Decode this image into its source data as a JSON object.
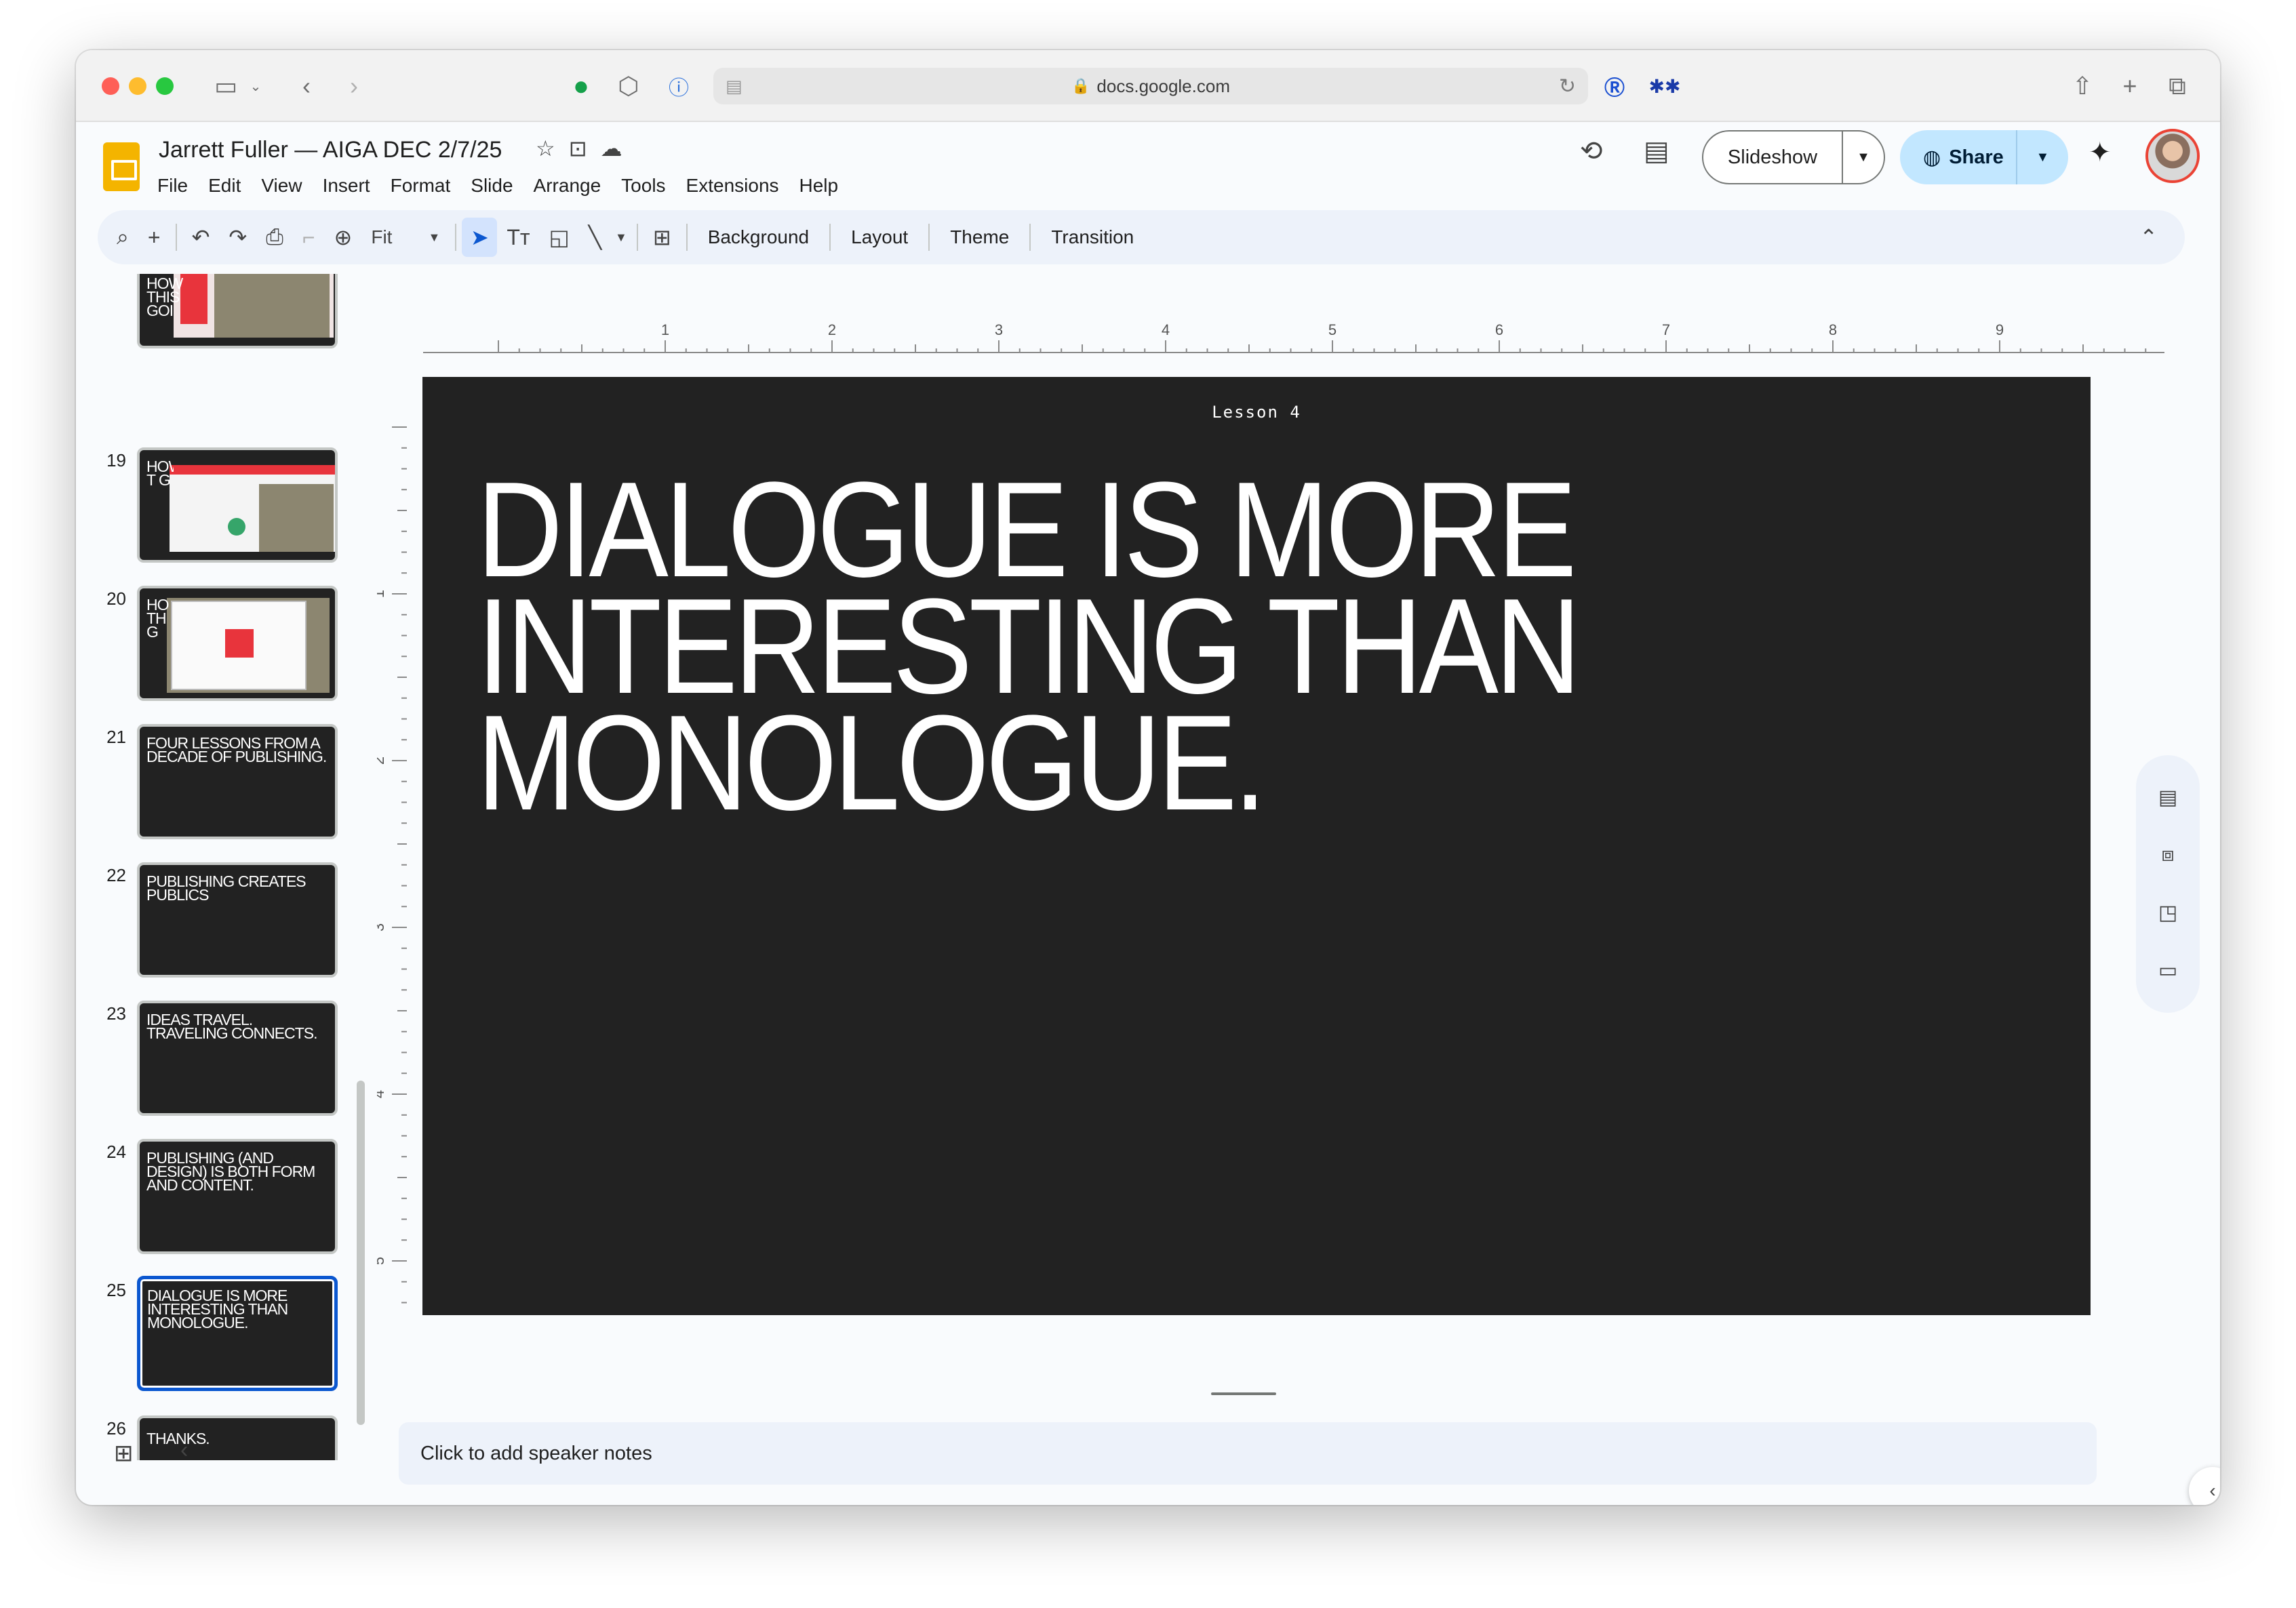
{
  "browser": {
    "url": "docs.google.com"
  },
  "doc": {
    "title": "Jarrett Fuller — AIGA DEC 2/7/25",
    "menu": [
      "File",
      "Edit",
      "View",
      "Insert",
      "Format",
      "Slide",
      "Arrange",
      "Tools",
      "Extensions",
      "Help"
    ]
  },
  "header": {
    "slideshow_label": "Slideshow",
    "share_label": "Share"
  },
  "toolbar": {
    "zoom_label": "Fit",
    "background_label": "Background",
    "layout_label": "Layout",
    "theme_label": "Theme",
    "transition_label": "Transition"
  },
  "filmstrip": {
    "partial_top_text": "HOW THIS GOI",
    "slides": [
      {
        "num": "19",
        "text": "HOW T G",
        "kind": "image"
      },
      {
        "num": "20",
        "text": "HO TH G",
        "kind": "image2"
      },
      {
        "num": "21",
        "text": "FOUR LESSONS FROM A DECADE OF PUBLISHING.",
        "kind": "text"
      },
      {
        "num": "22",
        "text": "PUBLISHING CREATES PUBLICS",
        "kind": "text"
      },
      {
        "num": "23",
        "text": "IDEAS TRAVEL. TRAVELING CONNECTS.",
        "kind": "text"
      },
      {
        "num": "24",
        "text": "PUBLISHING (AND DESIGN) IS BOTH FORM AND CONTENT.",
        "kind": "text"
      },
      {
        "num": "25",
        "text": "DIALOGUE IS MORE INTERESTING THAN MONOLOGUE.",
        "kind": "text",
        "selected": true
      },
      {
        "num": "26",
        "text": "THANKS.",
        "kind": "text"
      }
    ]
  },
  "ruler": {
    "h_labels": [
      "1",
      "2",
      "3",
      "4",
      "5",
      "6",
      "7",
      "8",
      "9"
    ],
    "v_labels": [
      "1",
      "2",
      "3",
      "4",
      "5"
    ]
  },
  "slide": {
    "kicker": "Lesson 4",
    "headline": "DIALOGUE IS MORE\nINTERESTING THAN\nMONOLOGUE."
  },
  "notes": {
    "placeholder": "Click to add speaker notes"
  },
  "colors": {
    "slide_bg": "#222222",
    "accent": "#0b57d0",
    "share_bg": "#c2e7ff"
  }
}
